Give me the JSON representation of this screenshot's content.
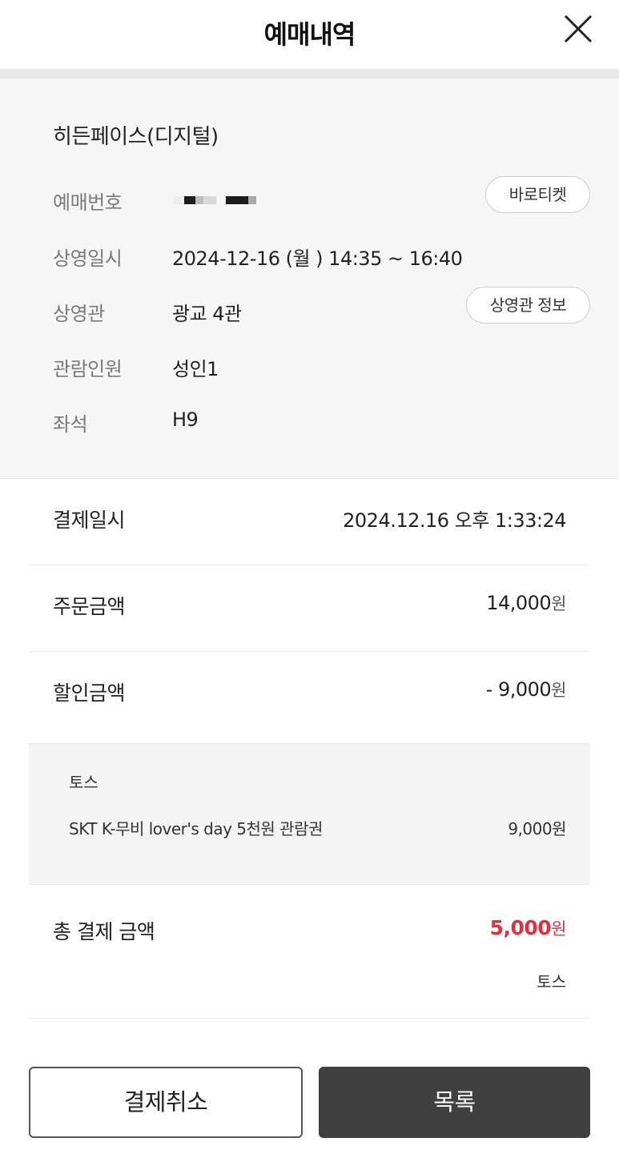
{
  "header": {
    "title": "예매내역",
    "close_icon": "close-icon"
  },
  "booking": {
    "movie_title": "히든페이스(디지털)",
    "booking_number": {
      "label": "예매번호",
      "value_masked": true
    },
    "showtime": {
      "label": "상영일시",
      "value": "2024-12-16 (월 ) 14:35 ~ 16:40"
    },
    "theater": {
      "label": "상영관",
      "value": "광교 4관"
    },
    "audience": {
      "label": "관람인원",
      "value": "성인1"
    },
    "seat": {
      "label": "좌석",
      "value": "H9"
    },
    "ticket_button": "바로티켓",
    "theater_info_button": "상영관 정보"
  },
  "payment": {
    "date": {
      "label": "결제일시",
      "value": "2024.12.16 오후 1:33:24"
    },
    "order_amount": {
      "label": "주문금액",
      "value": "14,000",
      "unit": "원"
    },
    "discount_amount": {
      "label": "할인금액",
      "value": "- 9,000",
      "unit": "원"
    },
    "discount_detail": {
      "provider": "토스",
      "item": "SKT K-무비 lover's day 5천원 관람권",
      "amount": "9,000원"
    },
    "total": {
      "label": "총 결제 금액",
      "value": "5,000",
      "unit": "원",
      "method": "토스"
    }
  },
  "buttons": {
    "cancel": "결제취소",
    "list": "목록"
  },
  "colors": {
    "accent_red": "#e0303b",
    "dark_button": "#404040",
    "panel_bg": "#f6f6f6"
  }
}
